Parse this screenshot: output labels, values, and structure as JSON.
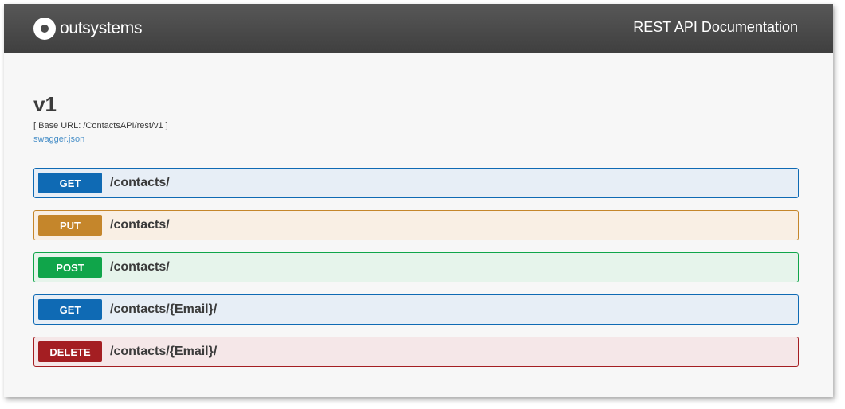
{
  "header": {
    "logo_text": "outsystems",
    "title": "REST API Documentation"
  },
  "api": {
    "version": "v1",
    "base_url": "[ Base URL: /ContactsAPI/rest/v1 ]",
    "swagger_link": "swagger.json"
  },
  "operations": [
    {
      "method": "GET",
      "path": "/contacts/",
      "color": "#0f6ab4",
      "bg": "#e7eef6",
      "border": "#0f6ab4"
    },
    {
      "method": "PUT",
      "path": "/contacts/",
      "color": "#c5862b",
      "bg": "#f9efe4",
      "border": "#c5862b"
    },
    {
      "method": "POST",
      "path": "/contacts/",
      "color": "#10a54a",
      "bg": "#e6f4eb",
      "border": "#10a54a"
    },
    {
      "method": "GET",
      "path": "/contacts/{Email}/",
      "color": "#0f6ab4",
      "bg": "#e7eef6",
      "border": "#0f6ab4"
    },
    {
      "method": "DELETE",
      "path": "/contacts/{Email}/",
      "color": "#a41e22",
      "bg": "#f5e7e8",
      "border": "#a41e22"
    }
  ]
}
